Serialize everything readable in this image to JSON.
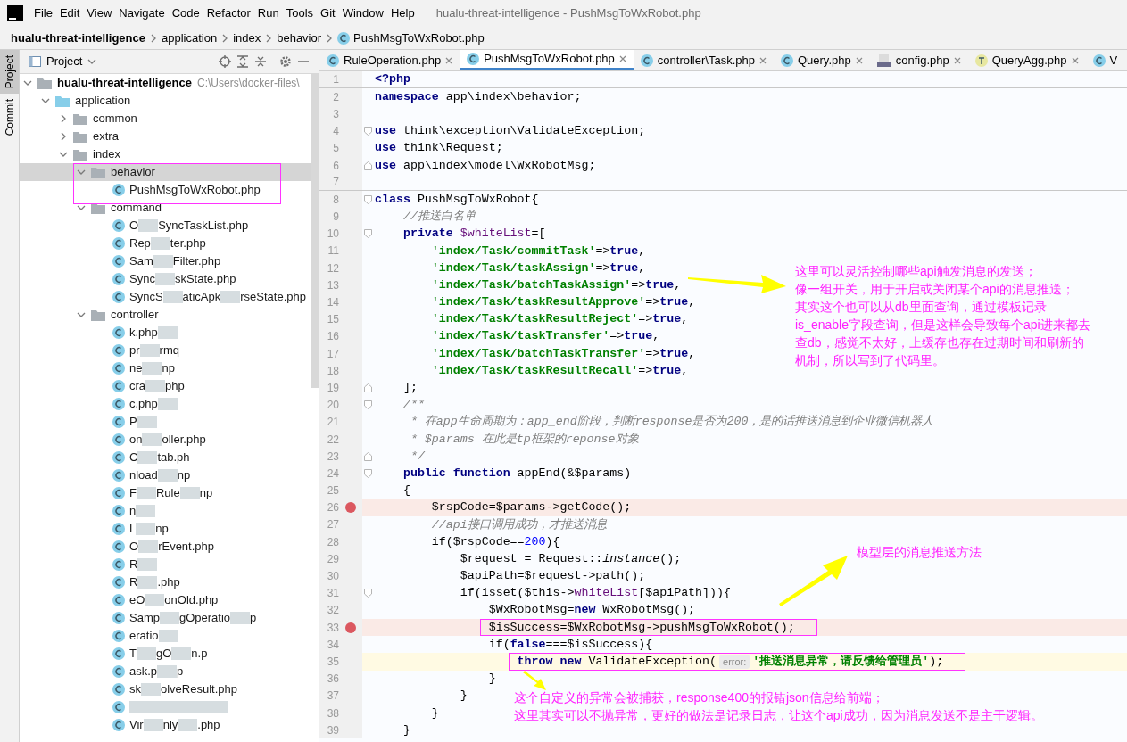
{
  "menu": [
    "File",
    "Edit",
    "View",
    "Navigate",
    "Code",
    "Refactor",
    "Run",
    "Tools",
    "Git",
    "Window",
    "Help"
  ],
  "window": {
    "title": "hualu-threat-intelligence - PushMsgToWxRobot.php"
  },
  "breadcrumbs": [
    {
      "label": "hualu-threat-intelligence",
      "kind": "project"
    },
    {
      "label": "application",
      "kind": "folder"
    },
    {
      "label": "index",
      "kind": "folder"
    },
    {
      "label": "behavior",
      "kind": "folder"
    },
    {
      "label": "PushMsgToWxRobot.php",
      "kind": "class"
    }
  ],
  "tool_strip": [
    {
      "label": "Project",
      "selected": true
    },
    {
      "label": "Commit",
      "selected": false
    }
  ],
  "project_panel": {
    "title": "Project"
  },
  "tree": [
    {
      "label": "hualu-threat-intelligence",
      "path": "C:\\Users\\docker-files\\",
      "kind": "root",
      "expanded": true,
      "selected": false,
      "children": [
        {
          "label": "application",
          "kind": "source",
          "expanded": true,
          "selected": false,
          "children": [
            {
              "label": "common",
              "kind": "folder",
              "expanded": false,
              "selected": false
            },
            {
              "label": "extra",
              "kind": "folder",
              "expanded": false,
              "selected": false
            },
            {
              "label": "index",
              "kind": "folder",
              "expanded": true,
              "selected": false,
              "children": [
                {
                  "label": "behavior",
                  "kind": "folder",
                  "expanded": true,
                  "selected": true,
                  "children": [
                    {
                      "parts": [
                        "PushMsgToWxRobot.php"
                      ],
                      "kind": "file",
                      "redacted": false,
                      "selected": false
                    }
                  ]
                },
                {
                  "label": "command",
                  "kind": "folder",
                  "expanded": true,
                  "selected": false,
                  "children": [
                    {
                      "parts": [
                        "O",
                        "SyncTaskList.php"
                      ],
                      "kind": "file",
                      "redacted": true,
                      "selected": false
                    },
                    {
                      "parts": [
                        "Rep",
                        "ter.php"
                      ],
                      "kind": "file",
                      "redacted": true,
                      "selected": false
                    },
                    {
                      "parts": [
                        "Sam",
                        "Filter.php"
                      ],
                      "kind": "file",
                      "redacted": true,
                      "selected": false
                    },
                    {
                      "parts": [
                        "Sync",
                        "skState.php"
                      ],
                      "kind": "file",
                      "redacted": true,
                      "selected": false
                    },
                    {
                      "parts": [
                        "SyncS",
                        "aticApk",
                        "rseState.php"
                      ],
                      "kind": "file",
                      "redacted": true,
                      "selected": false
                    }
                  ]
                },
                {
                  "label": "controller",
                  "kind": "folder",
                  "expanded": true,
                  "selected": false,
                  "children": [
                    {
                      "parts": [
                        "k.php"
                      ],
                      "kind": "file",
                      "redacted": true,
                      "selected": false
                    },
                    {
                      "parts": [
                        "pr",
                        "rmq"
                      ],
                      "kind": "file",
                      "redacted": true,
                      "selected": false
                    },
                    {
                      "parts": [
                        "ne",
                        "np"
                      ],
                      "kind": "file",
                      "redacted": true,
                      "selected": false
                    },
                    {
                      "parts": [
                        "cra",
                        "php"
                      ],
                      "kind": "file",
                      "redacted": true,
                      "selected": false
                    },
                    {
                      "parts": [
                        "c.php"
                      ],
                      "kind": "file",
                      "redacted": true,
                      "selected": false
                    },
                    {
                      "parts": [
                        "P"
                      ],
                      "kind": "file",
                      "redacted": true,
                      "selected": false
                    },
                    {
                      "parts": [
                        "on",
                        "oller.php"
                      ],
                      "kind": "file",
                      "redacted": true,
                      "selected": false
                    },
                    {
                      "parts": [
                        "C",
                        "tab.ph"
                      ],
                      "kind": "file",
                      "redacted": true,
                      "selected": false
                    },
                    {
                      "parts": [
                        "nload",
                        "np"
                      ],
                      "kind": "file",
                      "redacted": true,
                      "selected": false
                    },
                    {
                      "parts": [
                        "F",
                        "Rule",
                        "np"
                      ],
                      "kind": "file",
                      "redacted": true,
                      "selected": false
                    },
                    {
                      "parts": [
                        "n"
                      ],
                      "kind": "file",
                      "redacted": true,
                      "selected": false
                    },
                    {
                      "parts": [
                        "L",
                        "np"
                      ],
                      "kind": "file",
                      "redacted": true,
                      "selected": false
                    },
                    {
                      "parts": [
                        "O",
                        "rEvent.php"
                      ],
                      "kind": "file",
                      "redacted": true,
                      "selected": false
                    },
                    {
                      "parts": [
                        "R"
                      ],
                      "kind": "file",
                      "redacted": true,
                      "selected": false
                    },
                    {
                      "parts": [
                        "R",
                        ".php"
                      ],
                      "kind": "file",
                      "redacted": true,
                      "selected": false
                    },
                    {
                      "parts": [
                        "eO",
                        "onOld.php"
                      ],
                      "kind": "file",
                      "redacted": true,
                      "selected": false
                    },
                    {
                      "parts": [
                        "Samp",
                        "gOperatio",
                        "p"
                      ],
                      "kind": "file",
                      "redacted": true,
                      "selected": false
                    },
                    {
                      "parts": [
                        "eratio"
                      ],
                      "kind": "file",
                      "redacted": true,
                      "selected": false
                    },
                    {
                      "parts": [
                        "T",
                        "gO",
                        "n.p"
                      ],
                      "kind": "file",
                      "redacted": true,
                      "selected": false
                    },
                    {
                      "parts": [
                        "ask.p",
                        "p"
                      ],
                      "kind": "file",
                      "redacted": true,
                      "selected": false
                    },
                    {
                      "parts": [
                        "sk",
                        "olveResult.php"
                      ],
                      "kind": "file",
                      "redacted": true,
                      "selected": false
                    },
                    {
                      "kind": "file",
                      "redacted": true,
                      "selected": false
                    },
                    {
                      "parts": [
                        "Vir",
                        "nly",
                        ".php"
                      ],
                      "kind": "file",
                      "redacted": true,
                      "selected": false
                    }
                  ]
                }
              ]
            }
          ]
        }
      ]
    }
  ],
  "tabs": [
    {
      "label": "RuleOperation.php",
      "kind": "class",
      "selected": false
    },
    {
      "label": "PushMsgToWxRobot.php",
      "kind": "class",
      "selected": true
    },
    {
      "label": "controller\\Task.php",
      "kind": "class",
      "selected": false
    },
    {
      "label": "Query.php",
      "kind": "class",
      "selected": false
    },
    {
      "label": "config.php",
      "kind": "php",
      "selected": false
    },
    {
      "label": "QueryAgg.php",
      "kind": "trait",
      "selected": false
    },
    {
      "label": "V",
      "kind": "class",
      "selected": false
    }
  ],
  "editor": {
    "lines": [
      {
        "n": "1",
        "framed": false,
        "kind": "plain",
        "breakpoint": false,
        "current": false,
        "separator_below": true,
        "tokens": [
          {
            "kind": "kw",
            "t": "<?php"
          }
        ]
      },
      {
        "n": "2",
        "framed": false,
        "kind": "plain",
        "breakpoint": false,
        "current": false,
        "separator_below": false,
        "tokens": [
          {
            "kind": "kw",
            "t": "namespace"
          },
          {
            "kind": "plain",
            "t": " app\\index\\behavior;"
          }
        ]
      },
      {
        "n": "3",
        "framed": false,
        "kind": "plain",
        "breakpoint": false,
        "current": false,
        "separator_below": false
      },
      {
        "n": "4",
        "framed": false,
        "kind": "opener",
        "breakpoint": false,
        "current": false,
        "separator_below": false,
        "tokens": [
          {
            "kind": "kw",
            "t": "use"
          },
          {
            "kind": "plain",
            "t": " think\\exception\\ValidateException;"
          }
        ]
      },
      {
        "n": "5",
        "framed": false,
        "kind": "plain",
        "breakpoint": false,
        "current": false,
        "separator_below": false,
        "tokens": [
          {
            "kind": "kw",
            "t": "use"
          },
          {
            "kind": "plain",
            "t": " think\\Request;"
          }
        ]
      },
      {
        "n": "6",
        "framed": false,
        "kind": "closer",
        "breakpoint": false,
        "current": false,
        "separator_below": false,
        "tokens": [
          {
            "kind": "kw",
            "t": "use"
          },
          {
            "kind": "plain",
            "t": " app\\index\\model\\WxRobotMsg;"
          }
        ]
      },
      {
        "n": "7",
        "framed": false,
        "kind": "plain",
        "breakpoint": false,
        "current": false,
        "separator_below": true
      },
      {
        "n": "8",
        "framed": false,
        "kind": "opener",
        "breakpoint": false,
        "current": false,
        "separator_below": false,
        "tokens": [
          {
            "kind": "kw",
            "t": "class"
          },
          {
            "kind": "plain",
            "t": " PushMsgToWxRobot{"
          }
        ]
      },
      {
        "n": "9",
        "framed": false,
        "kind": "plain",
        "breakpoint": false,
        "current": false,
        "separator_below": false,
        "tokens": [
          {
            "kind": "cmt",
            "t": "    //推送白名单"
          }
        ]
      },
      {
        "n": "10",
        "framed": false,
        "kind": "opener",
        "breakpoint": false,
        "current": false,
        "separator_below": false,
        "tokens": [
          {
            "kind": "kw",
            "t": "    private"
          },
          {
            "kind": "var",
            "t": " $whiteList"
          },
          {
            "kind": "plain",
            "t": "=["
          }
        ]
      },
      {
        "n": "11",
        "framed": false,
        "kind": "plain",
        "breakpoint": false,
        "current": false,
        "separator_below": false,
        "tokens": [
          {
            "kind": "str",
            "t": "        'index/Task/commitTask'"
          },
          {
            "kind": "plain",
            "t": "=>"
          },
          {
            "kind": "kw",
            "t": "true"
          },
          {
            "kind": "plain",
            "t": ","
          }
        ]
      },
      {
        "n": "12",
        "framed": false,
        "kind": "plain",
        "breakpoint": false,
        "current": false,
        "separator_below": false,
        "tokens": [
          {
            "kind": "str",
            "t": "        'index/Task/taskAssign'"
          },
          {
            "kind": "plain",
            "t": "=>"
          },
          {
            "kind": "kw",
            "t": "true"
          },
          {
            "kind": "plain",
            "t": ","
          }
        ]
      },
      {
        "n": "13",
        "framed": false,
        "kind": "plain",
        "breakpoint": false,
        "current": false,
        "separator_below": false,
        "tokens": [
          {
            "kind": "str",
            "t": "        'index/Task/batchTaskAssign'"
          },
          {
            "kind": "plain",
            "t": "=>"
          },
          {
            "kind": "kw",
            "t": "true"
          },
          {
            "kind": "plain",
            "t": ","
          }
        ]
      },
      {
        "n": "14",
        "framed": false,
        "kind": "plain",
        "breakpoint": false,
        "current": false,
        "separator_below": false,
        "tokens": [
          {
            "kind": "str",
            "t": "        'index/Task/taskResultApprove'"
          },
          {
            "kind": "plain",
            "t": "=>"
          },
          {
            "kind": "kw",
            "t": "true"
          },
          {
            "kind": "plain",
            "t": ","
          }
        ]
      },
      {
        "n": "15",
        "framed": false,
        "kind": "plain",
        "breakpoint": false,
        "current": false,
        "separator_below": false,
        "tokens": [
          {
            "kind": "str",
            "t": "        'index/Task/taskResultReject'"
          },
          {
            "kind": "plain",
            "t": "=>"
          },
          {
            "kind": "kw",
            "t": "true"
          },
          {
            "kind": "plain",
            "t": ","
          }
        ]
      },
      {
        "n": "16",
        "framed": false,
        "kind": "plain",
        "breakpoint": false,
        "current": false,
        "separator_below": false,
        "tokens": [
          {
            "kind": "str",
            "t": "        'index/Task/taskTransfer'"
          },
          {
            "kind": "plain",
            "t": "=>"
          },
          {
            "kind": "kw",
            "t": "true"
          },
          {
            "kind": "plain",
            "t": ","
          }
        ]
      },
      {
        "n": "17",
        "framed": false,
        "kind": "plain",
        "breakpoint": false,
        "current": false,
        "separator_below": false,
        "tokens": [
          {
            "kind": "str",
            "t": "        'index/Task/batchTaskTransfer'"
          },
          {
            "kind": "plain",
            "t": "=>"
          },
          {
            "kind": "kw",
            "t": "true"
          },
          {
            "kind": "plain",
            "t": ","
          }
        ]
      },
      {
        "n": "18",
        "framed": false,
        "kind": "plain",
        "breakpoint": false,
        "current": false,
        "separator_below": false,
        "tokens": [
          {
            "kind": "str",
            "t": "        'index/Task/taskResultRecall'"
          },
          {
            "kind": "plain",
            "t": "=>"
          },
          {
            "kind": "kw",
            "t": "true"
          },
          {
            "kind": "plain",
            "t": ","
          }
        ]
      },
      {
        "n": "19",
        "framed": false,
        "kind": "closer",
        "breakpoint": false,
        "current": false,
        "separator_below": false,
        "tokens": [
          {
            "kind": "plain",
            "t": "    ];"
          }
        ]
      },
      {
        "n": "20",
        "framed": false,
        "kind": "opener",
        "breakpoint": false,
        "current": false,
        "separator_below": false,
        "tokens": [
          {
            "kind": "cmt",
            "t": "    /**"
          }
        ]
      },
      {
        "n": "21",
        "framed": false,
        "kind": "plain",
        "breakpoint": false,
        "current": false,
        "separator_below": false,
        "tokens": [
          {
            "kind": "cmt",
            "t": "     * 在app生命周期为：app_end阶段，判断response是否为200，是的话推送消息到企业微信机器人"
          }
        ]
      },
      {
        "n": "22",
        "framed": false,
        "kind": "plain",
        "breakpoint": false,
        "current": false,
        "separator_below": false,
        "tokens": [
          {
            "kind": "cmt",
            "t": "     * $params 在此是tp框架的reponse对象"
          }
        ]
      },
      {
        "n": "23",
        "framed": false,
        "kind": "closer",
        "breakpoint": false,
        "current": false,
        "separator_below": false,
        "tokens": [
          {
            "kind": "cmt",
            "t": "     */"
          }
        ]
      },
      {
        "n": "24",
        "framed": false,
        "kind": "opener",
        "breakpoint": false,
        "current": false,
        "separator_below": false,
        "tokens": [
          {
            "kind": "kw",
            "t": "    public function"
          },
          {
            "kind": "plain",
            "t": " appEnd(&$params)"
          }
        ]
      },
      {
        "n": "25",
        "framed": false,
        "kind": "plain",
        "breakpoint": false,
        "current": false,
        "separator_below": false,
        "tokens": [
          {
            "kind": "plain",
            "t": "    {"
          }
        ]
      },
      {
        "n": "26",
        "framed": false,
        "kind": "plain",
        "breakpoint": true,
        "current": false,
        "separator_below": false,
        "tokens": [
          {
            "kind": "plain",
            "t": "        $rspCode=$params->getCode();"
          }
        ]
      },
      {
        "n": "27",
        "framed": false,
        "kind": "plain",
        "breakpoint": false,
        "current": false,
        "separator_below": false,
        "tokens": [
          {
            "kind": "cmt",
            "t": "        //api接口调用成功，才推送消息"
          }
        ]
      },
      {
        "n": "28",
        "framed": false,
        "kind": "plain",
        "breakpoint": false,
        "current": false,
        "separator_below": false,
        "tokens": [
          {
            "kind": "plain",
            "t": "        if($rspCode=="
          },
          {
            "kind": "num",
            "t": "200"
          },
          {
            "kind": "plain",
            "t": "){"
          }
        ]
      },
      {
        "n": "29",
        "framed": false,
        "kind": "plain",
        "breakpoint": false,
        "current": false,
        "separator_below": false,
        "tokens": [
          {
            "kind": "plain",
            "t": "            $request = Request::"
          },
          {
            "kind": "it",
            "t": "instance"
          },
          {
            "kind": "plain",
            "t": "();"
          }
        ]
      },
      {
        "n": "30",
        "framed": false,
        "kind": "plain",
        "breakpoint": false,
        "current": false,
        "separator_below": false,
        "tokens": [
          {
            "kind": "plain",
            "t": "            $apiPath=$request->path();"
          }
        ]
      },
      {
        "n": "31",
        "framed": false,
        "kind": "opener",
        "breakpoint": false,
        "current": false,
        "separator_below": false,
        "tokens": [
          {
            "kind": "plain",
            "t": "            if(isset($this->"
          },
          {
            "kind": "var",
            "t": "whiteList"
          },
          {
            "kind": "plain",
            "t": "[$apiPath])){"
          }
        ]
      },
      {
        "n": "32",
        "framed": false,
        "kind": "plain",
        "breakpoint": false,
        "current": false,
        "separator_below": false,
        "tokens": [
          {
            "kind": "plain",
            "t": "                $WxRobotMsg="
          },
          {
            "kind": "kw",
            "t": "new"
          },
          {
            "kind": "plain",
            "t": " WxRobotMsg();"
          }
        ]
      },
      {
        "n": "33",
        "framed": true,
        "kind": "plain",
        "breakpoint": true,
        "current": false,
        "separator_below": false,
        "tokens": [
          {
            "kind": "plain",
            "t": "                $isSuccess=$WxRobotMsg->pushMsgToWxRobot();"
          }
        ]
      },
      {
        "n": "34",
        "framed": false,
        "kind": "plain",
        "breakpoint": false,
        "current": false,
        "separator_below": false,
        "tokens": [
          {
            "kind": "plain",
            "t": "                if("
          },
          {
            "kind": "kw",
            "t": "false"
          },
          {
            "kind": "plain",
            "t": "===$isSuccess){"
          }
        ]
      },
      {
        "n": "35",
        "framed": true,
        "kind": "plain",
        "breakpoint": false,
        "current": true,
        "separator_below": false,
        "tokens": [
          {
            "kind": "kw",
            "t": "                    throw new"
          },
          {
            "kind": "plain",
            "t": " ValidateException("
          },
          {
            "kind": "hint",
            "t": "error:"
          },
          {
            "kind": "str",
            "t": "'推送消息异常，请反馈给管理员'"
          },
          {
            "kind": "plain",
            "t": ");"
          }
        ]
      },
      {
        "n": "36",
        "framed": false,
        "kind": "plain",
        "breakpoint": false,
        "current": false,
        "separator_below": false,
        "tokens": [
          {
            "kind": "plain",
            "t": "                }"
          }
        ]
      },
      {
        "n": "37",
        "framed": false,
        "kind": "plain",
        "breakpoint": false,
        "current": false,
        "separator_below": false,
        "tokens": [
          {
            "kind": "plain",
            "t": "            }"
          }
        ]
      },
      {
        "n": "38",
        "framed": false,
        "kind": "plain",
        "breakpoint": false,
        "current": false,
        "separator_below": false,
        "tokens": [
          {
            "kind": "plain",
            "t": "        }"
          }
        ]
      },
      {
        "n": "39",
        "framed": false,
        "kind": "plain",
        "breakpoint": false,
        "current": false,
        "separator_below": false,
        "tokens": [
          {
            "kind": "plain",
            "t": "    }"
          }
        ]
      }
    ]
  },
  "annotations": [
    {
      "kind": "note",
      "lines": [
        "这里可以灵活控制哪些api触发消息的发送；",
        "像一组开关，用于开启或关闭某个api的消息推送；",
        "其实这个也可以从db里面查询，通过模板记录",
        "is_enable字段查询，但是这样会导致每个api进来都去",
        "查db，感觉不太好，上缓存也存在过期时间和刷新的",
        "机制，所以写到了代码里。"
      ]
    },
    {
      "kind": "note",
      "lines": [
        "模型层的消息推送方法"
      ]
    },
    {
      "kind": "note",
      "lines": [
        "这个自定义的异常会被捕获，response400的报错json信息给前端；",
        "这里其实可以不抛异常，更好的做法是记录日志，让这个api成功，因为消息发送不是主干逻辑。"
      ]
    }
  ]
}
